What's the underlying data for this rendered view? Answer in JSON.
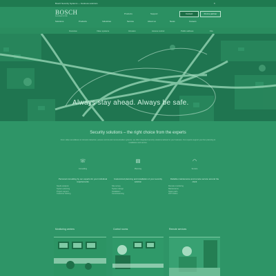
{
  "topbar": {
    "notice": "Bosch Security Systems — business solutions",
    "close": "×"
  },
  "header": {
    "logo": "BOSCH",
    "tagline": "Invented for life",
    "links": [
      "Products",
      "Support"
    ],
    "buttons": [
      "Contact",
      "Find a partner"
    ]
  },
  "nav": [
    "Solutions",
    "Products",
    "Industries",
    "Service",
    "About us",
    "News",
    "Careers"
  ],
  "subnav": [
    "Overview",
    "Video systems",
    "Intrusion",
    "Access control",
    "Public address",
    "Fire"
  ],
  "hero": {
    "title": "Always stay ahead. Always be safe."
  },
  "section": {
    "title": "Security solutions – the right choice from the experts",
    "intro": "From video surveillance to intrusion detection, access control and communication systems, we offer integrated security solutions tailored to your business. Our experts support you from planning to installation and service."
  },
  "columns": [
    {
      "icon": "phone-icon",
      "glyph": "☏",
      "label": "Consulting",
      "heading": "Personal consulting by our experts for your individual requirements",
      "items": [
        "Needs analysis",
        "System planning",
        "Project support",
        "Customer training"
      ]
    },
    {
      "icon": "clipboard-icon",
      "glyph": "▤",
      "label": "Planning",
      "heading": "Customized planning and installation of your security solution",
      "items": [
        "Site survey",
        "System design",
        "Installation",
        "Commissioning"
      ]
    },
    {
      "icon": "wifi-icon",
      "glyph": "◠",
      "label": "Service",
      "heading": "Reliable maintenance and remote service around the clock",
      "items": [
        "Remote monitoring",
        "Maintenance",
        "Spare parts",
        "24/7 hotline"
      ]
    }
  ],
  "cards": [
    {
      "title": "Monitoring centers"
    },
    {
      "title": "Control rooms"
    },
    {
      "title": "Remote services"
    }
  ]
}
